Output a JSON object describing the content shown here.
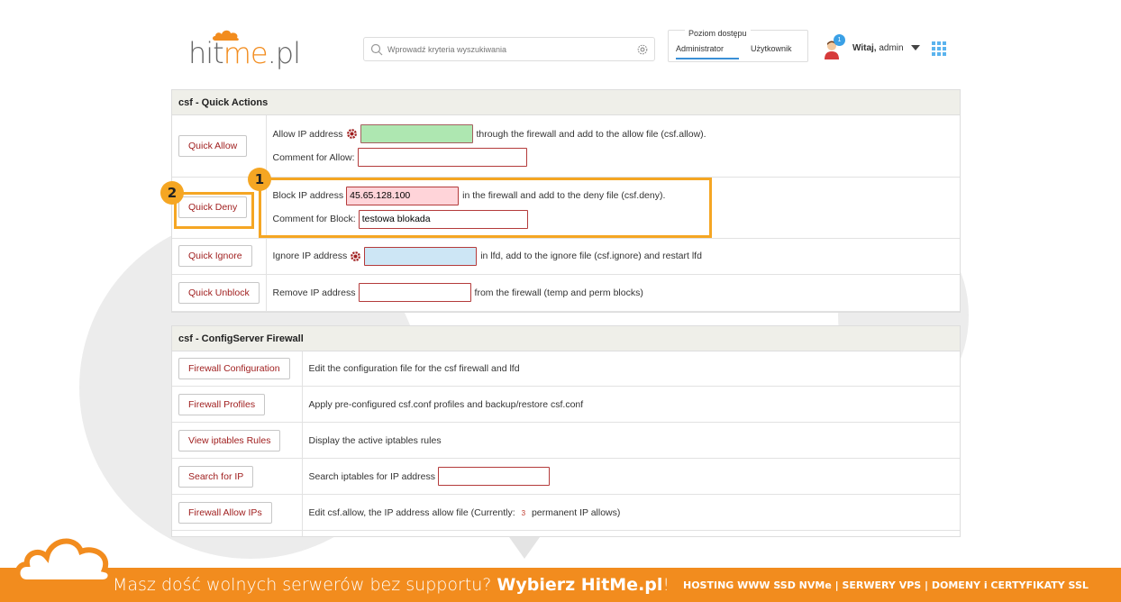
{
  "header": {
    "logo_text_1": "hit",
    "logo_text_2": "me",
    "logo_text_3": ".pl",
    "search_placeholder": "Wprowadź kryteria wyszukiwania",
    "access_title": "Poziom dostępu",
    "tab_admin": "Administrator",
    "tab_user": "Użytkownik",
    "badge": "1",
    "welcome_bold": "Witaj,",
    "welcome_user": " admin"
  },
  "quick_actions": {
    "title": "csf - Quick Actions",
    "allow": {
      "button": "Quick Allow",
      "ip_label": "Allow IP address",
      "ip_value": "",
      "suffix": "through the firewall and add to the allow file (csf.allow).",
      "comment_label": "Comment for Allow:",
      "comment_value": ""
    },
    "deny": {
      "button": "Quick Deny",
      "ip_label": "Block IP address",
      "ip_value": "45.65.128.100",
      "suffix": "in the firewall and add to the deny file (csf.deny).",
      "comment_label": "Comment for Block:",
      "comment_value": "testowa blokada"
    },
    "ignore": {
      "button": "Quick Ignore",
      "ip_label": "Ignore IP address",
      "ip_value": "",
      "suffix": "in lfd, add to the ignore file (csf.ignore) and restart lfd"
    },
    "unblock": {
      "button": "Quick Unblock",
      "ip_label": "Remove IP address",
      "ip_value": "",
      "suffix": "from the firewall (temp and perm blocks)"
    }
  },
  "firewall": {
    "title": "csf - ConfigServer Firewall",
    "rows": [
      {
        "button": "Firewall Configuration",
        "desc": "Edit the configuration file for the csf firewall and lfd"
      },
      {
        "button": "Firewall Profiles",
        "desc": "Apply pre-configured csf.conf profiles and backup/restore csf.conf"
      },
      {
        "button": "View iptables Rules",
        "desc": "Display the active iptables rules"
      },
      {
        "button": "Search for IP",
        "desc": "Search iptables for IP address"
      },
      {
        "button": "Firewall Allow IPs",
        "desc": "Edit csf.allow, the IP address allow file (Currently:",
        "count": "3",
        "desc_after": "permanent IP allows)"
      }
    ]
  },
  "annotations": {
    "marker_1": "1",
    "marker_2": "2",
    "color": "#f5a623"
  },
  "footer": {
    "text_plain": "Masz dość wolnych serwerów bez supportu? ",
    "text_bold": "Wybierz HitMe.pl",
    "text_end": "!",
    "right": "HOSTING WWW SSD NVMe | SERWERY VPS | DOMENY i CERTYFIKATY SSL",
    "color": "#f28c1e"
  }
}
